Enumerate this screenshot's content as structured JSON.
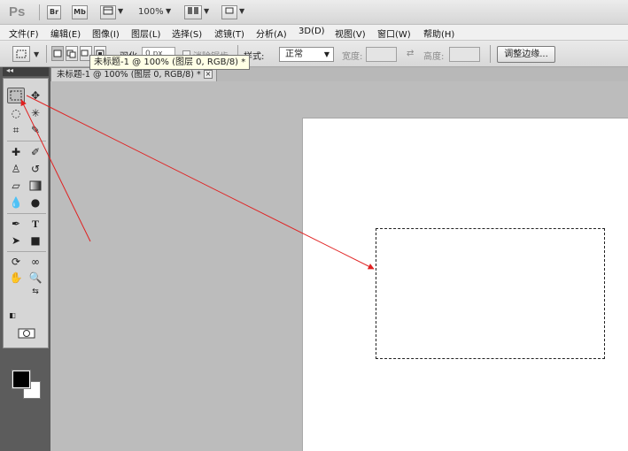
{
  "appbar": {
    "logo": "Ps",
    "bridge_label": "Br",
    "minibridge_label": "Mb",
    "zoom": "100%"
  },
  "menu": [
    "文件(F)",
    "编辑(E)",
    "图像(I)",
    "图层(L)",
    "选择(S)",
    "滤镜(T)",
    "分析(A)",
    "3D(D)",
    "视图(V)",
    "窗口(W)",
    "帮助(H)"
  ],
  "options": {
    "feather_label": "羽化:",
    "feather_value": "0 px",
    "antialias_label": "消除锯齿",
    "style_label": "样式:",
    "style_value": "正常",
    "width_label": "宽度:",
    "height_label": "高度:",
    "refine_edge_button": "调整边缘..."
  },
  "document": {
    "tab_title": "未标题-1 @ 100% (图层 0, RGB/8) *",
    "tab_close": "×",
    "tooltip": "未标题-1 @ 100% (图层 0, RGB/8) *"
  },
  "tools": {
    "collapse_glyph": "◂◂",
    "selected": "rectangular-marquee-tool"
  },
  "colors": {
    "foreground": "#000000",
    "background": "#ffffff",
    "annotation_arrow": "#e02020"
  }
}
